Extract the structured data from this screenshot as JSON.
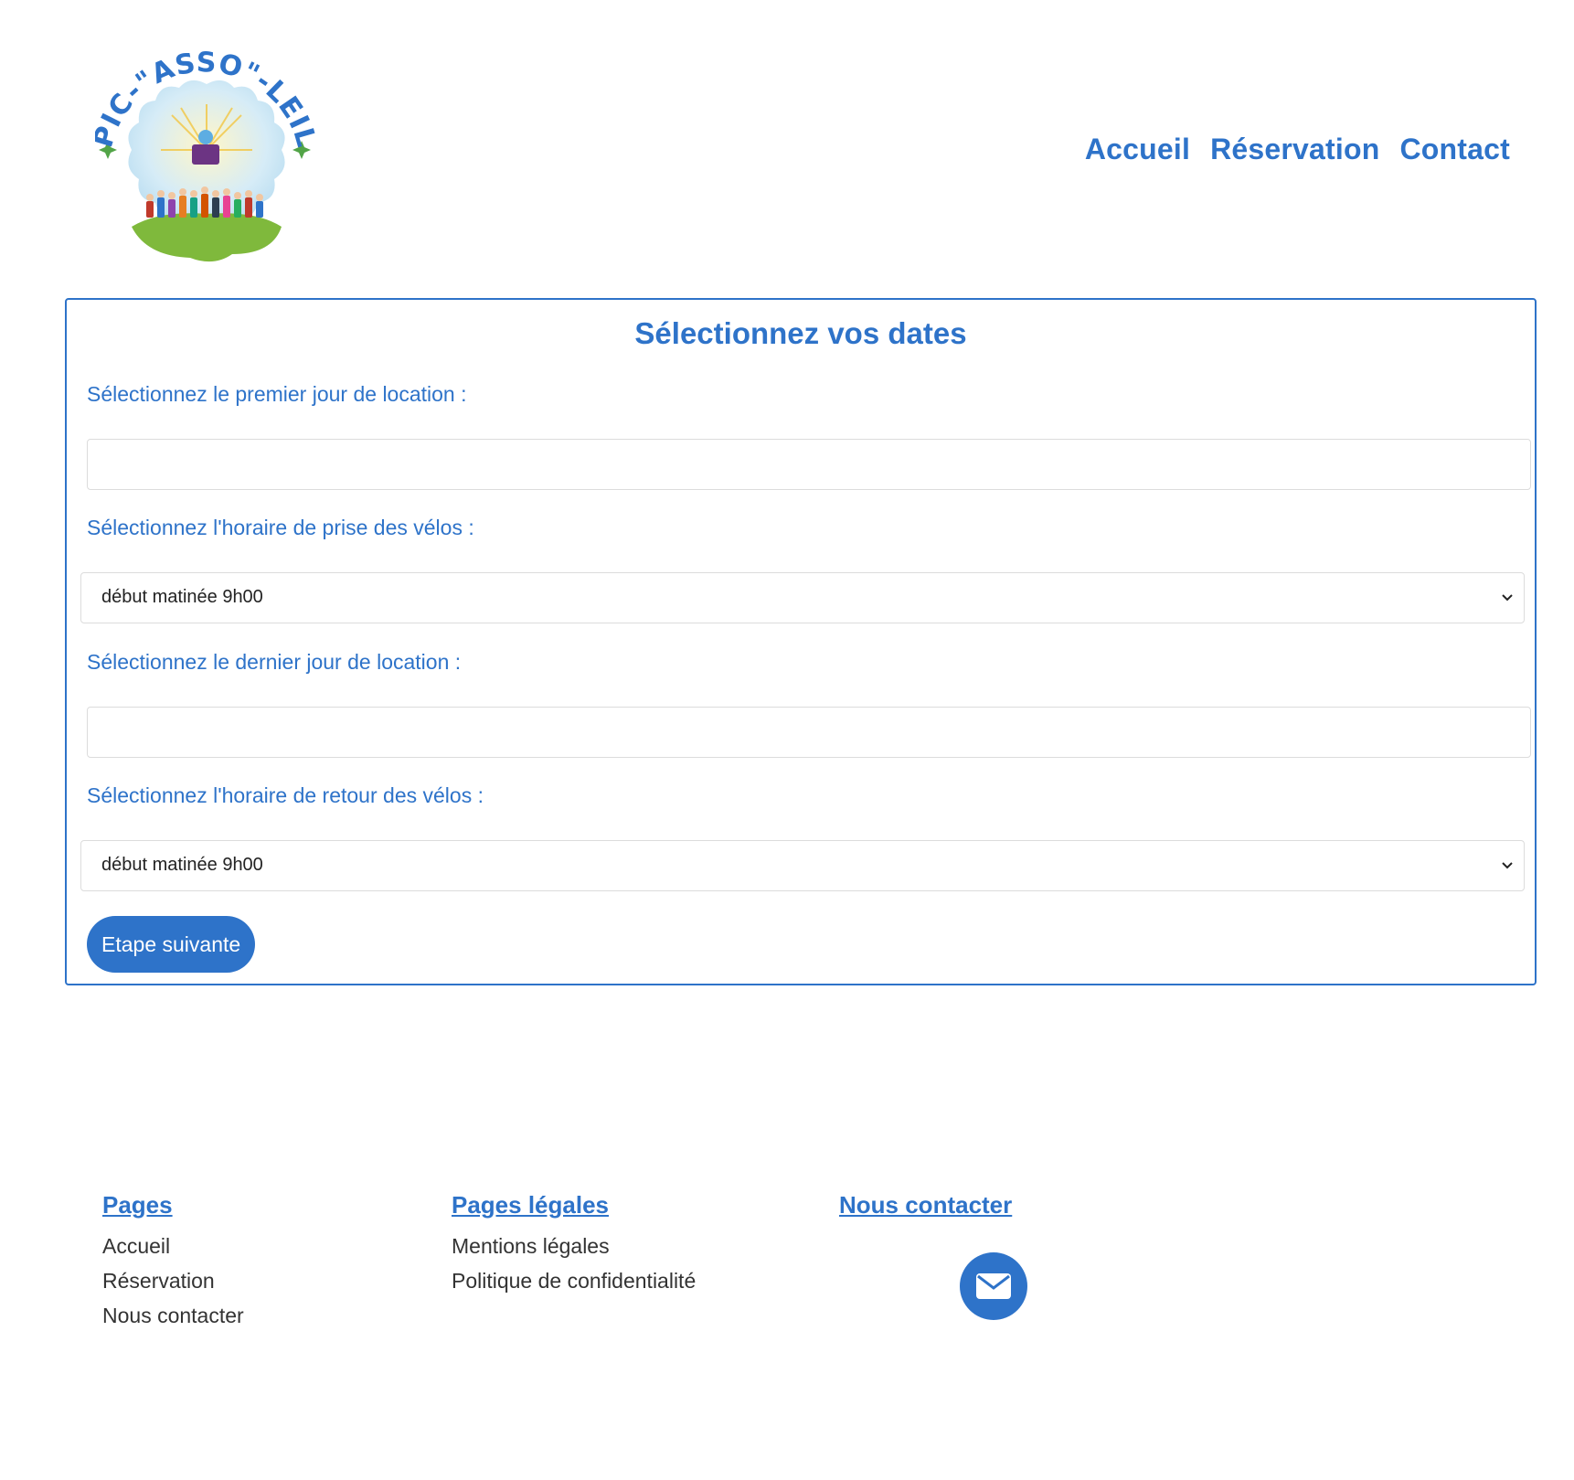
{
  "brand": {
    "logo_text": "PIC-\"ASSO\"-LEIL",
    "primary_color": "#2e73c9"
  },
  "nav": {
    "items": [
      {
        "label": "Accueil"
      },
      {
        "label": "Réservation"
      },
      {
        "label": "Contact"
      }
    ]
  },
  "form": {
    "title": "Sélectionnez vos dates",
    "first_day_label": "Sélectionnez le premier jour de location :",
    "first_day_value": "",
    "pickup_time_label": "Sélectionnez l'horaire de prise des vélos :",
    "pickup_time_value": "début matinée 9h00",
    "last_day_label": "Sélectionnez le dernier jour de location :",
    "last_day_value": "",
    "return_time_label": "Sélectionnez l'horaire de retour des vélos :",
    "return_time_value": "début matinée 9h00",
    "next_button": "Etape suivante"
  },
  "footer": {
    "pages": {
      "heading": "Pages",
      "links": [
        "Accueil",
        "Réservation",
        "Nous contacter"
      ]
    },
    "legal": {
      "heading": "Pages légales",
      "links": [
        "Mentions légales",
        "Politique de confidentialité"
      ]
    },
    "contact": {
      "heading": "Nous contacter",
      "icon": "envelope-icon"
    }
  }
}
